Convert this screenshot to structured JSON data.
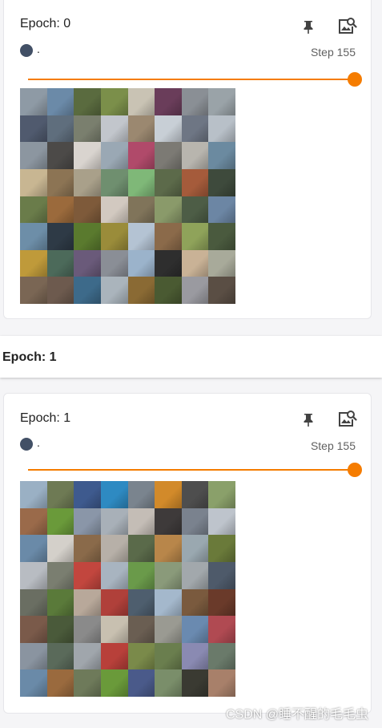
{
  "colors": {
    "accent": "#f57c00",
    "run_dot": "#425066"
  },
  "cards": [
    {
      "title": "Epoch: 0",
      "run_name": ".",
      "step": "Step 155",
      "slider_fraction": 1.0,
      "pin_icon": "pin-icon",
      "image_icon": "image-search-icon",
      "image_grid_colors": [
        "#8e9aa5",
        "#6b8aa8",
        "#5a6b3f",
        "#7b8f4a",
        "#c9c3b4",
        "#6a3d5a",
        "#8a8f95",
        "#9aa3a8",
        "#505a6e",
        "#5f6e7d",
        "#7a7f6e",
        "#c2c6cc",
        "#9b8870",
        "#c8cfd6",
        "#6e7684",
        "#b8c0c8",
        "#8c96a0",
        "#4c4a48",
        "#d9d4cf",
        "#9aa8b4",
        "#b04a6a",
        "#7c7a74",
        "#b8b5ae",
        "#6b8aa0",
        "#c8b692",
        "#8c7454",
        "#a9a08a",
        "#6f8f6f",
        "#7fb878",
        "#5c6a4a",
        "#a55b3b",
        "#3e4a3c",
        "#6a7c4a",
        "#9b6a3c",
        "#7e5a3a",
        "#d2c9c0",
        "#80745a",
        "#8a9a6a",
        "#4d5d46",
        "#6c86a4",
        "#6d8ea8",
        "#2e3a46",
        "#5a7a2e",
        "#9a8c3a",
        "#b4c3d3",
        "#8b6a4a",
        "#8fa35a",
        "#4a5a3e",
        "#bf9a3a",
        "#4c6a5a",
        "#6a5a7a",
        "#8a8e96",
        "#9bb3cb",
        "#2e2e2e",
        "#c9b296",
        "#a8aa9a",
        "#7a6654",
        "#6d5a4e",
        "#3d6a8a",
        "#aab4bc",
        "#8a6a34",
        "#4a5a32",
        "#9a9aa0",
        "#5a4e44"
      ]
    },
    {
      "title": "Epoch: 1",
      "run_name": ".",
      "step": "Step 155",
      "slider_fraction": 1.0,
      "pin_icon": "pin-icon",
      "image_icon": "image-search-icon",
      "image_grid_colors": [
        "#9ab0c4",
        "#6e7a54",
        "#3e5a8e",
        "#2e8ac2",
        "#7a848e",
        "#d28a2a",
        "#4e4e4e",
        "#8aa06a",
        "#9a6a4a",
        "#6a9a3a",
        "#8a96a8",
        "#a8b0b8",
        "#c4bdb6",
        "#3e3a3a",
        "#7a828e",
        "#bec4cc",
        "#6a8aa8",
        "#d4d0ca",
        "#8a6a4a",
        "#b7b0a8",
        "#5a6a4a",
        "#b8864a",
        "#9aa8b0",
        "#6a7a3a",
        "#b8bcc2",
        "#7a7e70",
        "#c2463e",
        "#a8b4c0",
        "#6a9a4a",
        "#8a9a7a",
        "#a2a8ac",
        "#4e5a6a",
        "#6a6e62",
        "#5a7a3a",
        "#b8a89a",
        "#b0403a",
        "#4e5e6e",
        "#a4b8cc",
        "#7a5a3e",
        "#6a3a2a",
        "#7a5a4a",
        "#4a5a3a",
        "#8a8a8a",
        "#c8c0b0",
        "#6a5e52",
        "#9a9a92",
        "#6a8ab0",
        "#b04a52",
        "#8a94a0",
        "#5a6a5a",
        "#a0a6ac",
        "#b8403a",
        "#7a8a4a",
        "#6a7e4e",
        "#8a8ab2",
        "#6a7a6a",
        "#6a8aa8",
        "#9a6a3e",
        "#6e7a5a",
        "#6a9a3a",
        "#4a5a8a",
        "#7a8e6a",
        "#3a3a32",
        "#a8806a"
      ]
    }
  ],
  "epoch_bar": {
    "label": "Epoch: 1"
  },
  "watermark": "CSDN @睡不醒的毛毛虫"
}
